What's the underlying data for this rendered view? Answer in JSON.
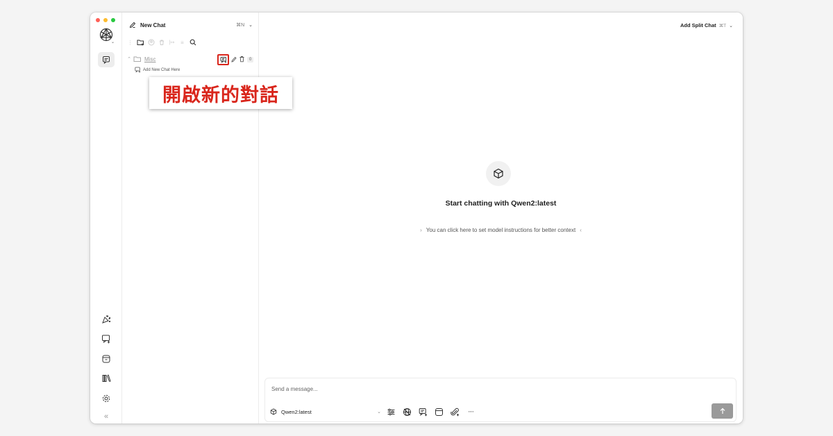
{
  "window": {
    "traffic_light_colors": [
      "#ff5f57",
      "#febc2e",
      "#28c840"
    ]
  },
  "sidebar": {
    "new_chat_label": "New Chat",
    "new_chat_shortcut": "⌘N",
    "folders": [
      {
        "name": "Misc",
        "chat_count": "0",
        "add_chat_label": "Add New Chat Here"
      }
    ]
  },
  "header": {
    "split_chat_label": "Add Split Chat",
    "split_chat_shortcut": "⌘T"
  },
  "main": {
    "start_title": "Start chatting with Qwen2:latest",
    "instructions_hint": "You can click here to set model instructions for better context",
    "instructions_arrow_left": "›",
    "instructions_arrow_right": "‹"
  },
  "composer": {
    "placeholder": "Send a message...",
    "model_name": "Qwen2:latest",
    "more_label": "···"
  },
  "annotation": {
    "callout_text": "開啟新的對話",
    "highlight_color": "#d9261c"
  }
}
